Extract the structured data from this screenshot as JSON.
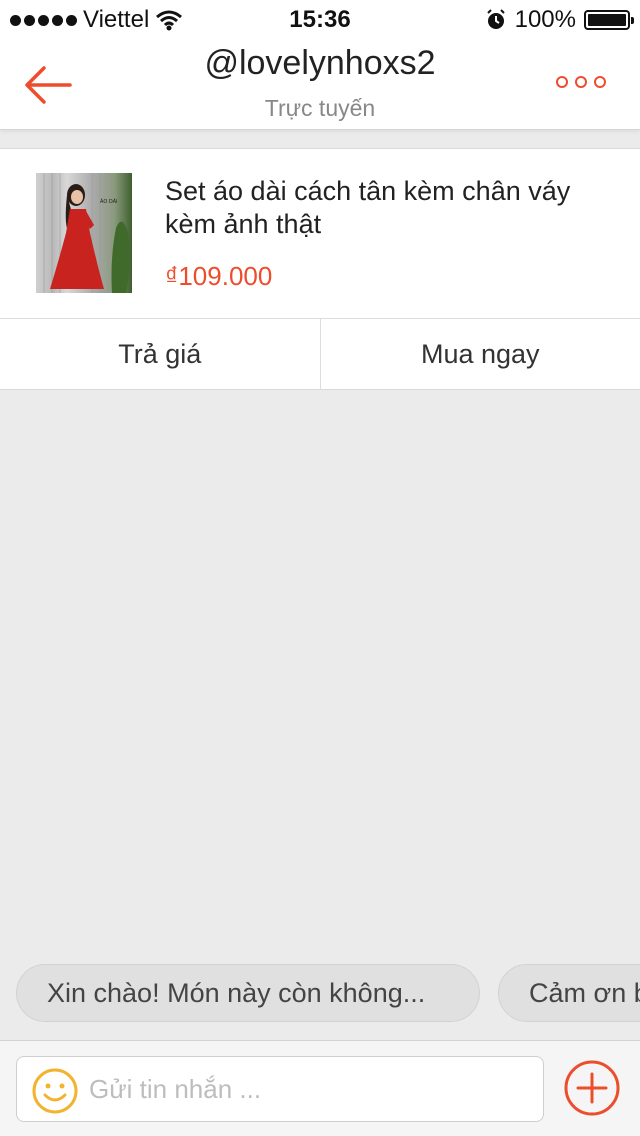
{
  "status_bar": {
    "carrier": "Viettel",
    "time": "15:36",
    "battery": "100%",
    "battery_level": 1.0,
    "icons": [
      "signal-icon",
      "wifi-icon",
      "alarm-icon",
      "battery-icon"
    ]
  },
  "header": {
    "title": "@lovelynhoxs2",
    "subtitle": "Trực tuyến",
    "back_icon": "arrow-left-icon",
    "more_icon": "more-dots-icon"
  },
  "product": {
    "name": "Set áo dài cách tân kèm chân váy kèm ảnh thật",
    "price": "₫109.000",
    "thumbnail_caption": "ÁO DÀI",
    "actions": {
      "offer_label": "Trả giá",
      "buy_label": "Mua ngay"
    }
  },
  "quick_replies": [
    "Xin chào! Món này còn không...",
    "Cảm ơn b"
  ],
  "composer": {
    "placeholder": "Gửi tin nhắn ...",
    "emoji_icon": "smiley-icon",
    "add_icon": "plus-circle-icon"
  },
  "colors": {
    "accent": "#ee4d2d",
    "emoji": "#f2b32e",
    "background": "#ebebeb"
  }
}
